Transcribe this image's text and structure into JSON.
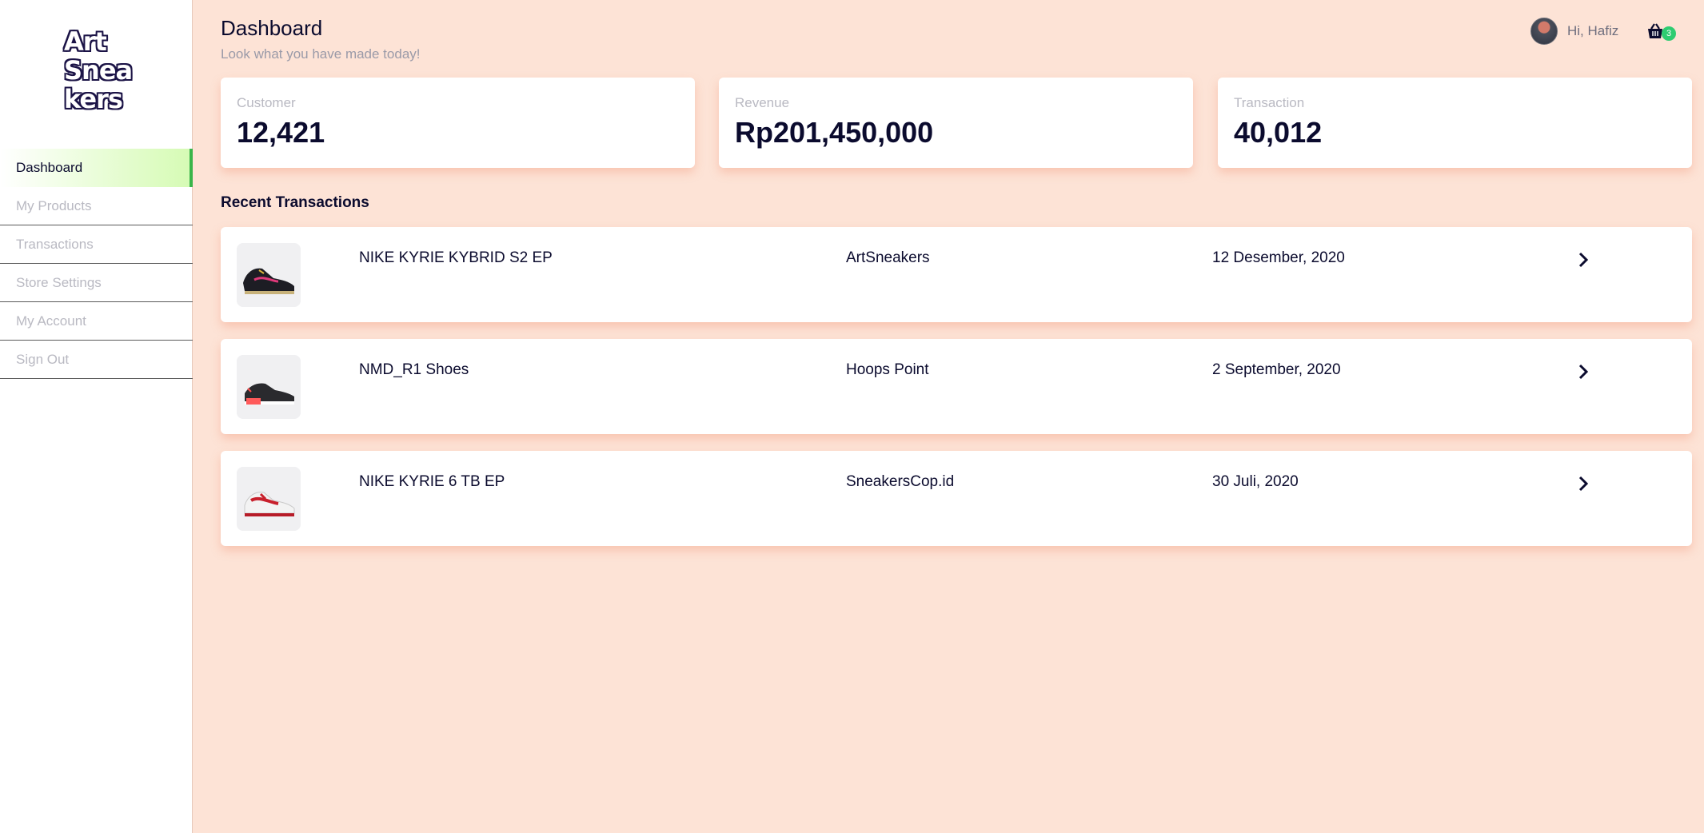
{
  "brand": {
    "logo_lines": [
      "Art",
      "Snea",
      "kers"
    ]
  },
  "sidebar": {
    "items": [
      {
        "label": "Dashboard",
        "active": true
      },
      {
        "label": "My Products"
      },
      {
        "label": "Transactions"
      },
      {
        "label": "Store Settings"
      },
      {
        "label": "My Account"
      },
      {
        "label": "Sign Out"
      }
    ]
  },
  "header": {
    "title": "Dashboard",
    "subtitle": "Look what you have made today!",
    "greeting": "Hi, Hafiz",
    "cart_count": "3"
  },
  "stats": [
    {
      "label": "Customer",
      "value": "12,421"
    },
    {
      "label": "Revenue",
      "value": "Rp201,450,000"
    },
    {
      "label": "Transaction",
      "value": "40,012"
    }
  ],
  "recent": {
    "title": "Recent Transactions",
    "rows": [
      {
        "product": "NIKE KYRIE KYBRID S2 EP",
        "store": "ArtSneakers",
        "date": "12 Desember, 2020",
        "thumb_icon": "sneaker-thumb-icon"
      },
      {
        "product": "NMD_R1 Shoes",
        "store": "Hoops Point",
        "date": "2 September, 2020",
        "thumb_icon": "sneaker-thumb-icon"
      },
      {
        "product": "NIKE KYRIE 6 TB EP",
        "store": "SneakersCop.id",
        "date": "30 Juli, 2020",
        "thumb_icon": "sneaker-thumb-icon"
      }
    ]
  },
  "colors": {
    "background": "#fde3d6",
    "accent_green": "#39b54a",
    "badge": "#2ecc71",
    "text_dark": "#0b0b2e"
  }
}
